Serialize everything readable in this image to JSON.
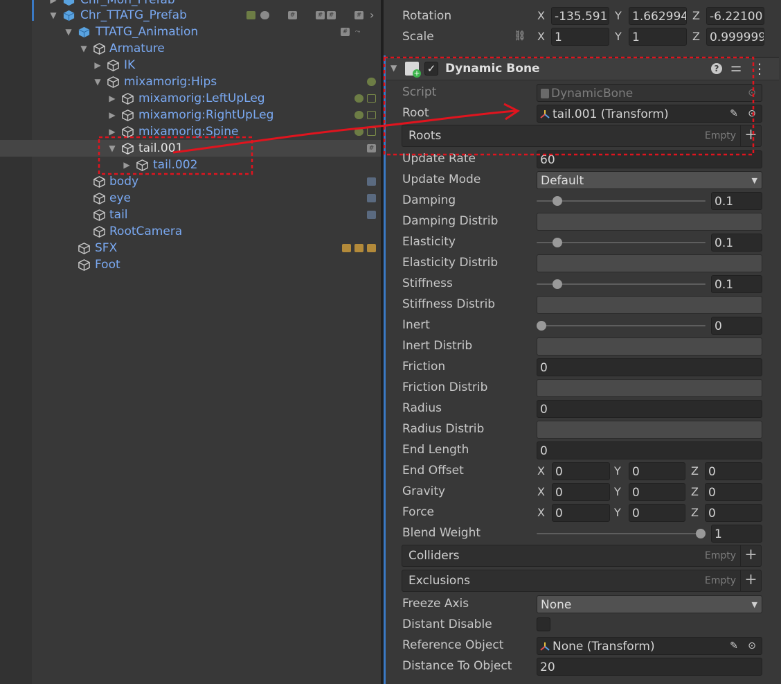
{
  "hierarchy": {
    "rows": [
      {
        "name": "Chr_Mon_Prefab",
        "depth": 0,
        "prefab": true
      },
      {
        "name": "Chr_TTATG_Prefab",
        "depth": 0,
        "prefab": true
      },
      {
        "name": "TTATG_Animation",
        "depth": 1,
        "prefab": true
      },
      {
        "name": "Armature",
        "depth": 2
      },
      {
        "name": "IK",
        "depth": 3
      },
      {
        "name": "mixamorig:Hips",
        "depth": 3
      },
      {
        "name": "mixamorig:LeftUpLeg",
        "depth": 4
      },
      {
        "name": "mixamorig:RightUpLeg",
        "depth": 4
      },
      {
        "name": "mixamorig:Spine",
        "depth": 4
      },
      {
        "name": "tail.001",
        "depth": 4,
        "selected": true
      },
      {
        "name": "tail.002",
        "depth": 5
      },
      {
        "name": "body",
        "depth": 2
      },
      {
        "name": "eye",
        "depth": 2
      },
      {
        "name": "tail",
        "depth": 2
      },
      {
        "name": "RootCamera",
        "depth": 2
      },
      {
        "name": "SFX",
        "depth": 1
      },
      {
        "name": "Foot",
        "depth": 1
      }
    ]
  },
  "transform": {
    "rotation_label": "Rotation",
    "scale_label": "Scale",
    "rotation": {
      "x": "-135.591",
      "y": "1.662994",
      "z": "-6.22100"
    },
    "scale": {
      "x": "1",
      "y": "1",
      "z": "0.999999"
    },
    "axis": {
      "x": "X",
      "y": "Y",
      "z": "Z"
    }
  },
  "component": {
    "title": "Dynamic Bone",
    "script_label": "Script",
    "script_value": "DynamicBone",
    "root_label": "Root",
    "root_value": "tail.001 (Transform)",
    "roots_label": "Roots",
    "empty": "Empty",
    "update_rate_label": "Update Rate",
    "update_rate": "60",
    "update_mode_label": "Update Mode",
    "update_mode": "Default",
    "damping_label": "Damping",
    "damping": "0.1",
    "damping_distrib_label": "Damping Distrib",
    "elasticity_label": "Elasticity",
    "elasticity": "0.1",
    "elasticity_distrib_label": "Elasticity Distrib",
    "stiffness_label": "Stiffness",
    "stiffness": "0.1",
    "stiffness_distrib_label": "Stiffness Distrib",
    "inert_label": "Inert",
    "inert": "0",
    "inert_distrib_label": "Inert Distrib",
    "friction_label": "Friction",
    "friction": "0",
    "friction_distrib_label": "Friction Distrib",
    "radius_label": "Radius",
    "radius": "0",
    "radius_distrib_label": "Radius Distrib",
    "end_length_label": "End Length",
    "end_length": "0",
    "end_offset_label": "End Offset",
    "end_offset": {
      "x": "0",
      "y": "0",
      "z": "0"
    },
    "gravity_label": "Gravity",
    "gravity": {
      "x": "0",
      "y": "0",
      "z": "0"
    },
    "force_label": "Force",
    "force": {
      "x": "0",
      "y": "0",
      "z": "0"
    },
    "blend_weight_label": "Blend Weight",
    "blend_weight": "1",
    "colliders_label": "Colliders",
    "exclusions_label": "Exclusions",
    "freeze_axis_label": "Freeze Axis",
    "freeze_axis": "None",
    "distant_disable_label": "Distant Disable",
    "reference_object_label": "Reference Object",
    "reference_object": "None (Transform)",
    "distance_label": "Distance To Object",
    "distance": "20"
  },
  "slider_levels": {
    "damping": 0.1,
    "elasticity": 0.1,
    "stiffness": 0.1,
    "inert": 0,
    "blend_weight": 1
  },
  "colors": {
    "accent": "#3a79c4",
    "annotation": "#e0141e",
    "hierarchy_text": "#7aa9f2"
  }
}
